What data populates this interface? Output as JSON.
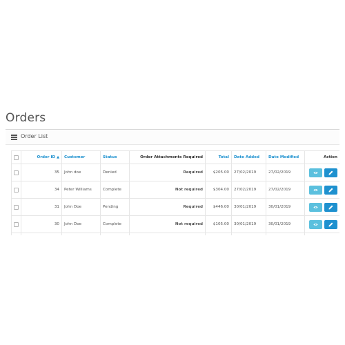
{
  "page": {
    "title": "Orders"
  },
  "panel": {
    "title": "Order List",
    "icon": "list-icon"
  },
  "table": {
    "headers": {
      "order_id": "Order ID",
      "customer": "Customer",
      "status": "Status",
      "attachments": "Order Attachments Required",
      "total": "Total",
      "date_added": "Date Added",
      "date_modified": "Date Modified",
      "action": "Action"
    },
    "sorted_column": "order_id",
    "sort_direction": "ascending",
    "rows": [
      {
        "order_id": "35",
        "customer": "John doe",
        "status": "Denied",
        "attachments": "Required",
        "total": "$205.00",
        "date_added": "27/02/2019",
        "date_modified": "27/02/2019"
      },
      {
        "order_id": "34",
        "customer": "Peter Williams",
        "status": "Complete",
        "attachments": "Not required",
        "total": "$304.00",
        "date_added": "27/02/2019",
        "date_modified": "27/02/2019"
      },
      {
        "order_id": "31",
        "customer": "John Doe",
        "status": "Pending",
        "attachments": "Required",
        "total": "$446.00",
        "date_added": "30/01/2019",
        "date_modified": "30/01/2019"
      },
      {
        "order_id": "30",
        "customer": "John Doe",
        "status": "Complete",
        "attachments": "Not required",
        "total": "$105.00",
        "date_added": "30/01/2019",
        "date_modified": "30/01/2019"
      },
      {
        "order_id": "",
        "customer": "",
        "status": "",
        "attachments": "",
        "total": "",
        "date_added": "",
        "date_modified": ""
      }
    ]
  },
  "colors": {
    "accent": "#1e91cf",
    "view_button": "#5bc0de",
    "required": "#f56b6b"
  },
  "icons": {
    "view": "eye-icon",
    "edit": "pencil-icon"
  }
}
